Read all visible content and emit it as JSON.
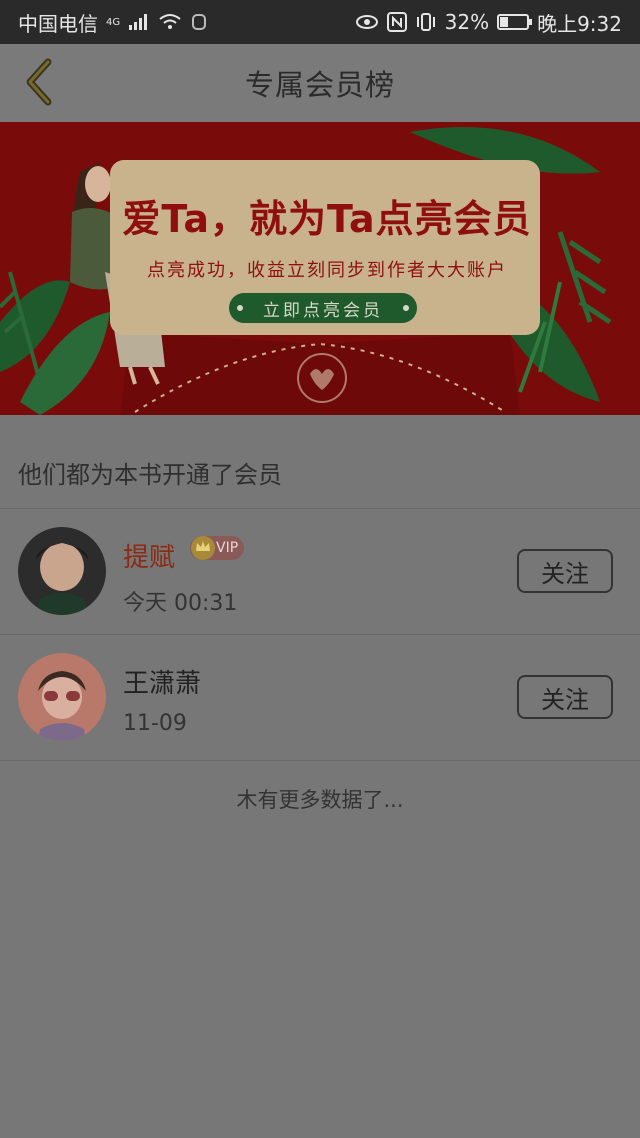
{
  "status_bar": {
    "carrier": "中国电信",
    "network": "4G",
    "battery": "32%",
    "battery_level": 0.32,
    "time": "晚上9:32"
  },
  "header": {
    "title": "专属会员榜"
  },
  "banner": {
    "title": "爱Ta，就为Ta点亮会员",
    "subtitle": "点亮成功，收益立刻同步到作者大大账户",
    "button_label": "立即点亮会员"
  },
  "section": {
    "label": "他们都为本书开通了会员"
  },
  "members": [
    {
      "name": "提赋",
      "badge": "VIP",
      "time": "今天 00:31",
      "follow_label": "关注"
    },
    {
      "name": "王潇萧",
      "badge": "",
      "time": "11-09",
      "follow_label": "关注"
    }
  ],
  "footer": {
    "text": "木有更多数据了..."
  },
  "colors": {
    "accent_name": "#8c2a14",
    "banner_red": "#7a0b0b",
    "banner_green": "#1f5a2c"
  }
}
